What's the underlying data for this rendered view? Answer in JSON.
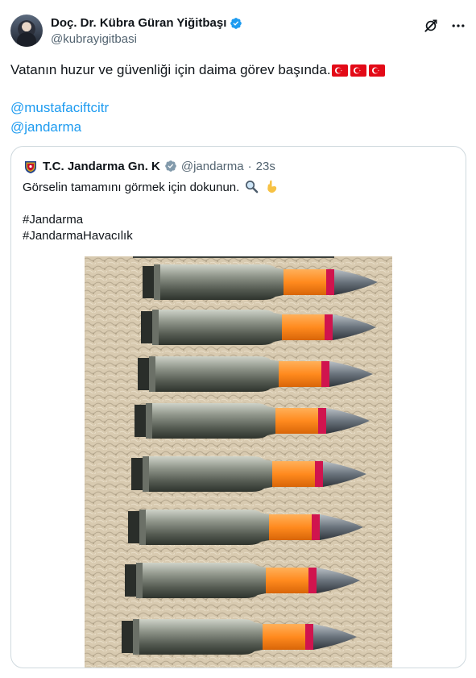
{
  "author": {
    "display_name": "Doç. Dr. Kübra Güran Yiğitbaşı",
    "handle": "@kubrayigitbasi"
  },
  "tweet": {
    "text": "Vatanın huzur ve güvenliği için daima görev başında.",
    "flags": [
      "turkey-flag",
      "turkey-flag",
      "turkey-flag"
    ],
    "mentions": [
      "@mustafaciftcitr",
      "@jandarma"
    ]
  },
  "quote": {
    "display_name": "T.C. Jandarma Gn. K",
    "handle": "@jandarma",
    "separator": "·",
    "time": "23s",
    "line1": "Görselin tamamını görmek için dokunun.",
    "line1_icons": [
      "magnifier-icon",
      "pointing-down-icon"
    ],
    "hashtag1": "#Jandarma",
    "hashtag2": "#JandarmaHavacılık",
    "media_alt_icon": "ammunition-photo"
  },
  "colors": {
    "link": "#1d9bf0",
    "verified": "#1d9bf0",
    "secondary_text": "#536471",
    "flag_red": "#e30a17",
    "casing": "#8a8f86",
    "tip_orange": "#ff8a1e",
    "tip_band": "#d0144e",
    "sand": "#d6c8ae"
  }
}
